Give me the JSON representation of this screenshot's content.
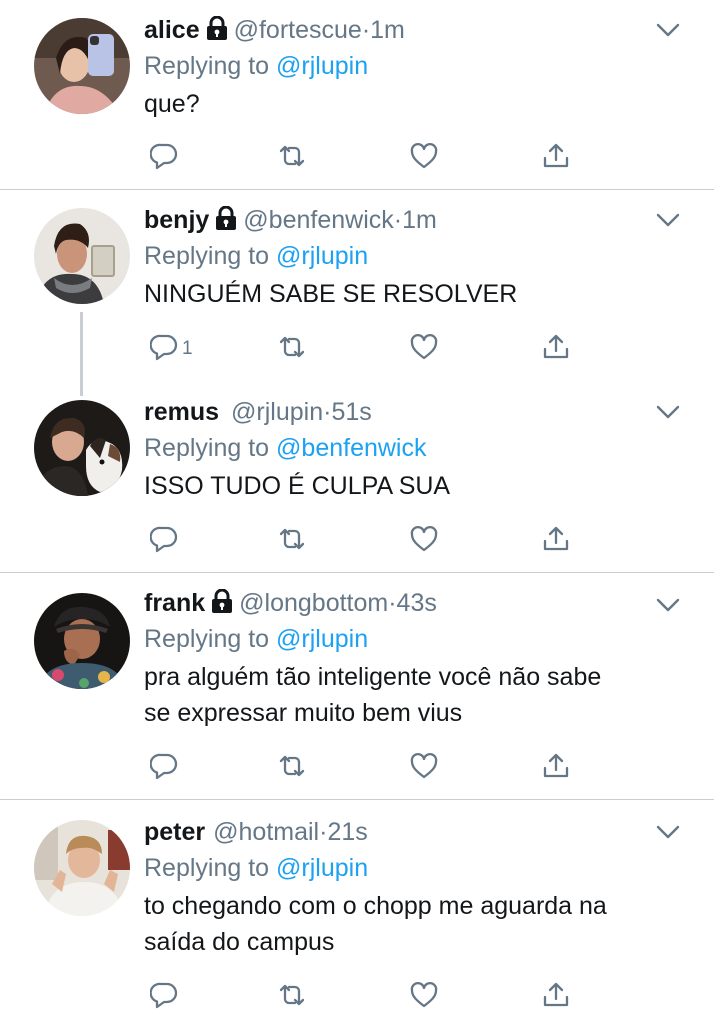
{
  "reply_prefix": "Replying to",
  "tweets": [
    {
      "name": "alice",
      "locked": true,
      "handle": "@fortescue",
      "sep": "·",
      "time": "1m",
      "replying_to": "@rjlupin",
      "text_lines": [
        "que?"
      ],
      "reply_count": ""
    },
    {
      "name": "benjy",
      "locked": true,
      "handle": "@benfenwick",
      "sep": "·",
      "time": "1m",
      "replying_to": "@rjlupin",
      "text_lines": [
        "NINGUÉM SABE SE RESOLVER"
      ],
      "reply_count": "1"
    },
    {
      "name": "remus",
      "locked": false,
      "handle": "@rjlupin",
      "sep": "·",
      "time": "51s",
      "replying_to": "@benfenwick",
      "text_lines": [
        "ISSO TUDO É CULPA SUA"
      ],
      "reply_count": ""
    },
    {
      "name": "frank",
      "locked": true,
      "handle": "@longbottom",
      "sep": "·",
      "time": "43s",
      "replying_to": "@rjlupin",
      "text_lines": [
        "pra alguém tão inteligente você não sabe",
        "se expressar muito bem vius"
      ],
      "reply_count": ""
    },
    {
      "name": "peter",
      "locked": false,
      "handle": "@hotmail",
      "sep": "·",
      "time": "21s",
      "replying_to": "@rjlupin",
      "text_lines": [
        "to chegando com o chopp me aguarda na",
        "saída do campus"
      ],
      "reply_count": ""
    }
  ],
  "icons": {
    "reply": "reply-icon",
    "retweet": "retweet-icon",
    "like": "heart-icon",
    "share": "share-icon",
    "caret": "chevron-down-icon",
    "lock": "lock-icon"
  },
  "colors": {
    "text": "#14171a",
    "secondary": "#657786",
    "accent": "#1da1f2",
    "divider": "#c8ced3"
  }
}
